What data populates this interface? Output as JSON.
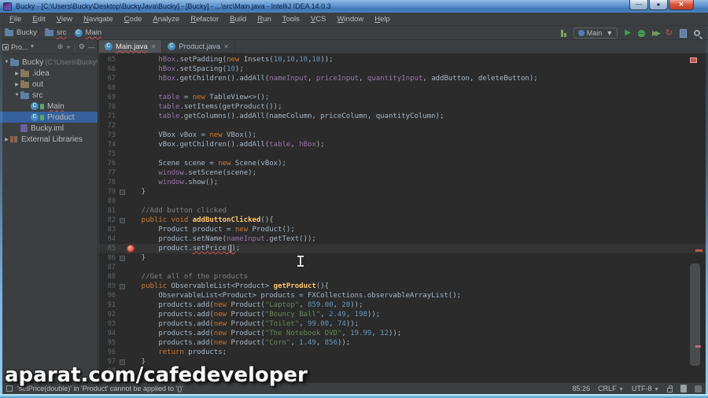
{
  "window": {
    "title": "Bucky - [C:\\Users\\Bucky\\Desktop\\BuckyJava\\Bucky] - [Bucky] - ...\\src\\Main.java - IntelliJ IDEA 14.0.3"
  },
  "menu": {
    "items": [
      "File",
      "Edit",
      "View",
      "Navigate",
      "Code",
      "Analyze",
      "Refactor",
      "Build",
      "Run",
      "Tools",
      "VCS",
      "Window",
      "Help"
    ]
  },
  "navbar": {
    "crumbs": [
      {
        "label": "Bucky",
        "icon": "project-folder-icon",
        "error": false
      },
      {
        "label": "src",
        "icon": "folder-icon",
        "error": true
      },
      {
        "label": "Main",
        "icon": "class-icon",
        "error": true
      }
    ]
  },
  "toolbar": {
    "run_config": "Main"
  },
  "project_panel": {
    "title": "Pro...",
    "items": [
      {
        "label": "Bucky",
        "sub": "(C:\\Users\\Bucky\\",
        "depth": 0,
        "icon": "project-folder",
        "expander": "dn"
      },
      {
        "label": ".idea",
        "depth": 1,
        "icon": "folder",
        "expander": "rt"
      },
      {
        "label": "out",
        "depth": 1,
        "icon": "folder",
        "expander": "rt"
      },
      {
        "label": "src",
        "depth": 1,
        "icon": "folder-src",
        "expander": "dn"
      },
      {
        "label": "Main",
        "depth": 2,
        "icon": "class",
        "error": true
      },
      {
        "label": "Product",
        "depth": 2,
        "icon": "class",
        "selected": true
      },
      {
        "label": "Bucky.iml",
        "depth": 1,
        "icon": "iml"
      },
      {
        "label": "External Libraries",
        "depth": 0,
        "icon": "library",
        "expander": "rt"
      }
    ]
  },
  "tabs": [
    {
      "label": "Main.java",
      "active": true,
      "error": true
    },
    {
      "label": "Product.java",
      "active": false,
      "error": false
    }
  ],
  "code": {
    "caret_line": 85,
    "bulb_line": 85,
    "fold_lines": [
      79,
      82,
      86,
      89,
      97
    ],
    "lines": [
      {
        "n": 65,
        "segs": [
          [
            "d",
            "        "
          ],
          [
            "f",
            "hBox"
          ],
          [
            "d",
            ".setPadding("
          ],
          [
            "k",
            "new"
          ],
          [
            "d",
            " Insets("
          ],
          [
            "n",
            "10"
          ],
          [
            "d",
            ","
          ],
          [
            "n",
            "10"
          ],
          [
            "d",
            ","
          ],
          [
            "n",
            "10"
          ],
          [
            "d",
            ","
          ],
          [
            "n",
            "10"
          ],
          [
            "d",
            "));"
          ]
        ]
      },
      {
        "n": 66,
        "segs": [
          [
            "d",
            "        "
          ],
          [
            "f",
            "hBox"
          ],
          [
            "d",
            ".setSpacing("
          ],
          [
            "n",
            "10"
          ],
          [
            "d",
            ");"
          ]
        ]
      },
      {
        "n": 67,
        "segs": [
          [
            "d",
            "        "
          ],
          [
            "f",
            "hBox"
          ],
          [
            "d",
            ".getChildren().addAll("
          ],
          [
            "f",
            "nameInput"
          ],
          [
            "d",
            ", "
          ],
          [
            "f",
            "priceInput"
          ],
          [
            "d",
            ", "
          ],
          [
            "f",
            "quantityInput"
          ],
          [
            "d",
            ", addButton, deleteButton);"
          ]
        ]
      },
      {
        "n": 68,
        "segs": []
      },
      {
        "n": 69,
        "segs": [
          [
            "d",
            "        "
          ],
          [
            "f",
            "table"
          ],
          [
            "d",
            " = "
          ],
          [
            "k",
            "new"
          ],
          [
            "d",
            " TableView<>();"
          ]
        ]
      },
      {
        "n": 70,
        "segs": [
          [
            "d",
            "        "
          ],
          [
            "f",
            "table"
          ],
          [
            "d",
            ".setItems(getProduct());"
          ]
        ]
      },
      {
        "n": 71,
        "segs": [
          [
            "d",
            "        "
          ],
          [
            "f",
            "table"
          ],
          [
            "d",
            ".getColumns().addAll(nameColumn, priceColumn, quantityColumn);"
          ]
        ]
      },
      {
        "n": 72,
        "segs": []
      },
      {
        "n": 73,
        "segs": [
          [
            "d",
            "        VBox vBox = "
          ],
          [
            "k",
            "new"
          ],
          [
            "d",
            " VBox();"
          ]
        ]
      },
      {
        "n": 74,
        "segs": [
          [
            "d",
            "        vBox.getChildren().addAll("
          ],
          [
            "f",
            "table"
          ],
          [
            "d",
            ", "
          ],
          [
            "f",
            "hBox"
          ],
          [
            "d",
            ");"
          ]
        ]
      },
      {
        "n": 75,
        "segs": []
      },
      {
        "n": 76,
        "segs": [
          [
            "d",
            "        Scene scene = "
          ],
          [
            "k",
            "new"
          ],
          [
            "d",
            " Scene(vBox);"
          ]
        ]
      },
      {
        "n": 77,
        "segs": [
          [
            "d",
            "        "
          ],
          [
            "f",
            "window"
          ],
          [
            "d",
            ".setScene(scene);"
          ]
        ]
      },
      {
        "n": 78,
        "segs": [
          [
            "d",
            "        "
          ],
          [
            "f",
            "window"
          ],
          [
            "d",
            ".show();"
          ]
        ]
      },
      {
        "n": 79,
        "segs": [
          [
            "d",
            "    }"
          ]
        ]
      },
      {
        "n": 80,
        "segs": []
      },
      {
        "n": 81,
        "segs": [
          [
            "c",
            "    //Add button clicked"
          ]
        ]
      },
      {
        "n": 82,
        "segs": [
          [
            "k",
            "    public void "
          ],
          [
            "m",
            "addButtonClicked"
          ],
          [
            "d",
            "(){"
          ]
        ]
      },
      {
        "n": 83,
        "segs": [
          [
            "d",
            "        Product product = "
          ],
          [
            "k",
            "new"
          ],
          [
            "d",
            " Product();"
          ]
        ]
      },
      {
        "n": 84,
        "segs": [
          [
            "d",
            "        product.setName("
          ],
          [
            "f",
            "nameInput"
          ],
          [
            "d",
            ".getText());"
          ]
        ]
      },
      {
        "n": 85,
        "segs": [
          [
            "d",
            "        product."
          ],
          [
            "e",
            "setPrice("
          ],
          [
            "caret",
            ""
          ],
          [
            "e",
            ")"
          ],
          [
            "d",
            ";"
          ]
        ]
      },
      {
        "n": 86,
        "segs": [
          [
            "d",
            "    }"
          ]
        ]
      },
      {
        "n": 87,
        "segs": []
      },
      {
        "n": 88,
        "segs": [
          [
            "c",
            "    //Get all of the products"
          ]
        ]
      },
      {
        "n": 89,
        "segs": [
          [
            "k",
            "    public "
          ],
          [
            "d",
            "ObservableList<Product> "
          ],
          [
            "m",
            "getProduct"
          ],
          [
            "d",
            "(){"
          ]
        ]
      },
      {
        "n": 90,
        "segs": [
          [
            "d",
            "        ObservableList<Product> products = FXCollections.observableArrayList();"
          ]
        ]
      },
      {
        "n": 91,
        "segs": [
          [
            "d",
            "        products.add("
          ],
          [
            "k",
            "new"
          ],
          [
            "d",
            " Product("
          ],
          [
            "s",
            "\"Laptop\""
          ],
          [
            "d",
            ", "
          ],
          [
            "n",
            "859.00"
          ],
          [
            "d",
            ", "
          ],
          [
            "n",
            "20"
          ],
          [
            "d",
            "));"
          ]
        ]
      },
      {
        "n": 92,
        "segs": [
          [
            "d",
            "        products.add("
          ],
          [
            "k",
            "new"
          ],
          [
            "d",
            " Product("
          ],
          [
            "s",
            "\"Bouncy Ball\""
          ],
          [
            "d",
            ", "
          ],
          [
            "n",
            "2.49"
          ],
          [
            "d",
            ", "
          ],
          [
            "n",
            "198"
          ],
          [
            "d",
            "));"
          ]
        ]
      },
      {
        "n": 93,
        "segs": [
          [
            "d",
            "        products.add("
          ],
          [
            "k",
            "new"
          ],
          [
            "d",
            " Product("
          ],
          [
            "s",
            "\"Toilet\""
          ],
          [
            "d",
            ", "
          ],
          [
            "n",
            "99.00"
          ],
          [
            "d",
            ", "
          ],
          [
            "n",
            "74"
          ],
          [
            "d",
            "));"
          ]
        ]
      },
      {
        "n": 94,
        "segs": [
          [
            "d",
            "        products.add("
          ],
          [
            "k",
            "new"
          ],
          [
            "d",
            " Product("
          ],
          [
            "s",
            "\"The Notebook DVD\""
          ],
          [
            "d",
            ", "
          ],
          [
            "n",
            "19.99"
          ],
          [
            "d",
            ", "
          ],
          [
            "n",
            "12"
          ],
          [
            "d",
            "));"
          ]
        ]
      },
      {
        "n": 95,
        "segs": [
          [
            "d",
            "        products.add("
          ],
          [
            "k",
            "new"
          ],
          [
            "d",
            " Product("
          ],
          [
            "s",
            "\"Corn\""
          ],
          [
            "d",
            ", "
          ],
          [
            "n",
            "1.49"
          ],
          [
            "d",
            ", "
          ],
          [
            "n",
            "856"
          ],
          [
            "d",
            "));"
          ]
        ]
      },
      {
        "n": 96,
        "segs": [
          [
            "k",
            "        return"
          ],
          [
            "d",
            " products;"
          ]
        ]
      },
      {
        "n": 97,
        "segs": [
          [
            "d",
            "    }"
          ]
        ]
      },
      {
        "n": 98,
        "segs": []
      }
    ]
  },
  "status_bar": {
    "message": "'setPrice(double)' in 'Product' cannot be applied to '()'",
    "position": "85:26",
    "line_ending": "CRLF",
    "encoding": "UTF-8"
  },
  "watermark": "aparat.com/cafedeveloper"
}
